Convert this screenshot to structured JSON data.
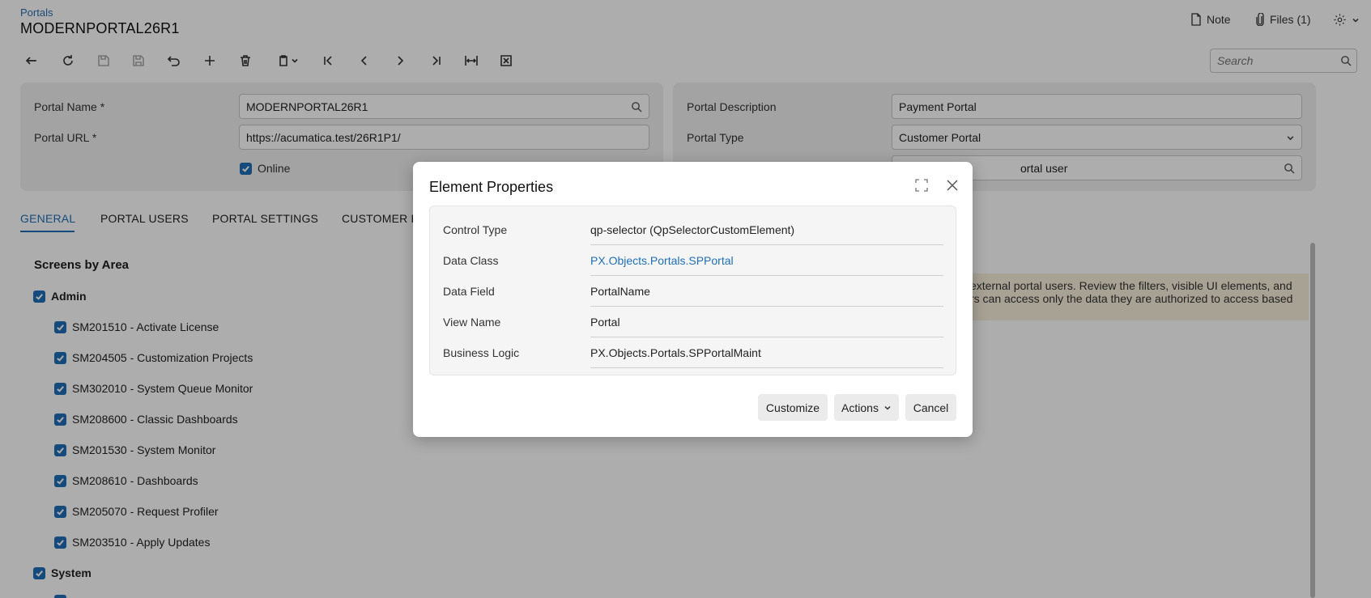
{
  "header": {
    "breadcrumb": "Portals",
    "title": "MODERNPORTAL26R1",
    "note_label": "Note",
    "files_label": "Files (1)"
  },
  "toolbar": {
    "search_placeholder": "Search"
  },
  "form": {
    "portal_name_label": "Portal Name *",
    "portal_name_value": "MODERNPORTAL26R1",
    "portal_url_label": "Portal URL *",
    "portal_url_value": "https://acumatica.test/26R1P1/",
    "online_label": "Online",
    "portal_description_label": "Portal Description",
    "portal_description_value": "Payment Portal",
    "portal_type_label": "Portal Type",
    "portal_type_value": "Customer Portal",
    "partial_value": "ortal user"
  },
  "tabs": [
    {
      "label": "GENERAL",
      "active": true
    },
    {
      "label": "PORTAL USERS",
      "active": false
    },
    {
      "label": "PORTAL SETTINGS",
      "active": false
    },
    {
      "label": "CUSTOMER F",
      "active": false
    }
  ],
  "screens": {
    "title": "Screens by Area",
    "groups": [
      {
        "label": "Admin",
        "items": [
          "SM201510 - Activate License",
          "SM204505 - Customization Projects",
          "SM302010 - System Queue Monitor",
          "SM208600 - Classic Dashboards",
          "SM201530 - System Monitor",
          "SM208610 - Dashboards",
          "SM205070 - Request Profiler",
          "SM203510 - Apply Updates"
        ]
      },
      {
        "label": "System",
        "items": []
      }
    ]
  },
  "warning": {
    "line1": "external portal users. Review the filters, visible UI elements, and",
    "line2": "rs can access only the data they are authorized to access based"
  },
  "modal": {
    "title": "Element Properties",
    "properties": [
      {
        "label": "Control Type",
        "value": "qp-selector (QpSelectorCustomElement)",
        "link": false
      },
      {
        "label": "Data Class",
        "value": "PX.Objects.Portals.SPPortal",
        "link": true
      },
      {
        "label": "Data Field",
        "value": "PortalName",
        "link": false
      },
      {
        "label": "View Name",
        "value": "Portal",
        "link": false
      },
      {
        "label": "Business Logic",
        "value": "PX.Objects.Portals.SPPortalMaint",
        "link": false
      }
    ],
    "customize_label": "Customize",
    "actions_label": "Actions",
    "cancel_label": "Cancel"
  },
  "colors": {
    "accent": "#1f6fb7",
    "warning_bg": "#f8efdc",
    "panel_bg": "#f1f1f1"
  }
}
